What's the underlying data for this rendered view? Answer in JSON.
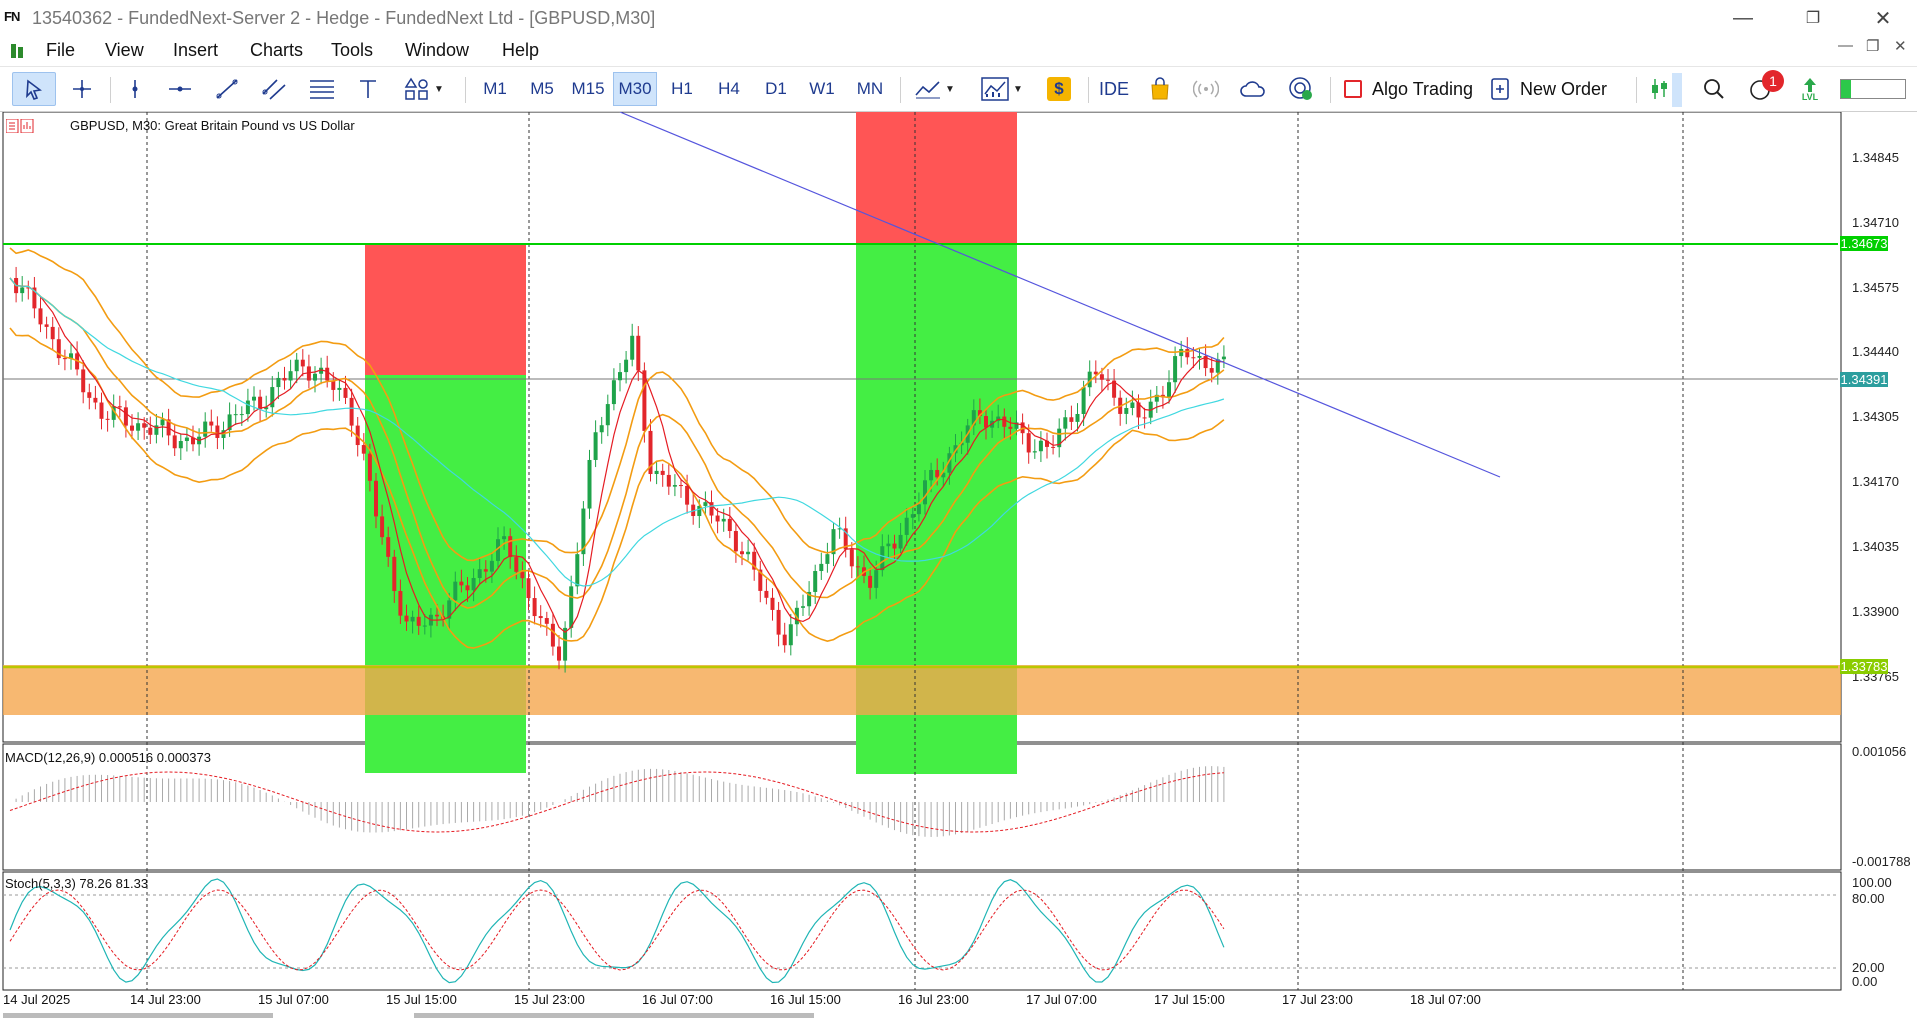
{
  "window": {
    "logo": "FN",
    "title": "13540362 - FundedNext-Server 2 - Hedge - FundedNext Ltd - [GBPUSD,M30]"
  },
  "menu": [
    "File",
    "View",
    "Insert",
    "Charts",
    "Tools",
    "Window",
    "Help"
  ],
  "timeframes": [
    "M1",
    "M5",
    "M15",
    "M30",
    "H1",
    "H4",
    "D1",
    "W1",
    "MN"
  ],
  "toolbar": {
    "ide_label": "IDE",
    "algo_label": "Algo Trading",
    "new_order_label": "New Order",
    "notification_count": "1",
    "lvl_label": "LVL"
  },
  "chart": {
    "header": "GBPUSD, M30:  Great Britain Pound vs US Dollar",
    "macd_label": "MACD(12,26,9) 0.000516 0.000373",
    "stoch_label": "Stoch(5,3,3) 78.26 81.33",
    "price_scale": [
      "1.34845",
      "1.34710",
      "1.34575",
      "1.34440",
      "1.34305",
      "1.34170",
      "1.34035",
      "1.33900",
      "1.33765"
    ],
    "price_boxes": {
      "upper": "1.34673",
      "current": "1.34391",
      "lower": "1.33783"
    },
    "macd_scale": [
      "0.001056",
      "-0.001788"
    ],
    "stoch_scale": [
      "100.00",
      "80.00",
      "20.00",
      "0.00"
    ],
    "time_labels": [
      "14 Jul 2025",
      "14 Jul 23:00",
      "15 Jul 07:00",
      "15 Jul 15:00",
      "15 Jul 23:00",
      "16 Jul 07:00",
      "16 Jul 15:00",
      "16 Jul 23:00",
      "17 Jul 07:00",
      "17 Jul 15:00",
      "17 Jul 23:00",
      "18 Jul 07:00"
    ],
    "colors": {
      "up_candle": "#1fa34a",
      "down_candle": "#e2262b",
      "green_line": "#00d000",
      "zone_orange": "#f5a64d",
      "bollinger": "#f39c12",
      "ma_red": "#e51c23",
      "ma_cyan": "#40d8e0",
      "ma_blue": "#5555dd",
      "sl_zone": "#ff5555",
      "tp_zone": "#44ee44"
    }
  }
}
